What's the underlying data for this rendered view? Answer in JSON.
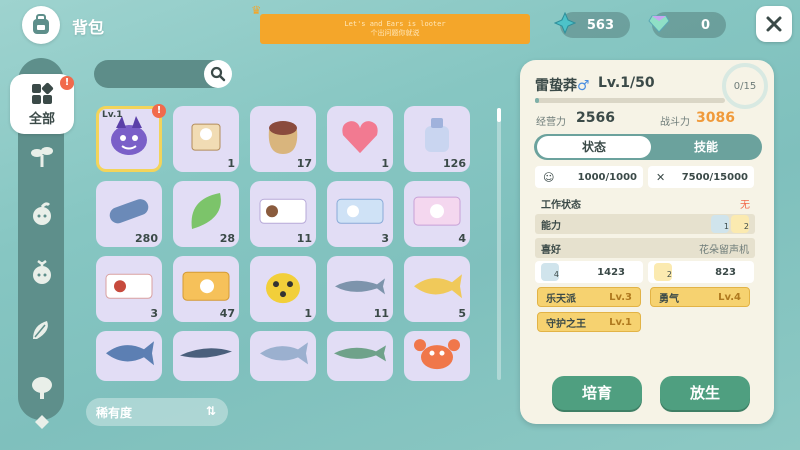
{
  "header": {
    "title": "背包",
    "notice_line1": "Let's and Ears is looter",
    "notice_line2": "个出问题你就说",
    "resources": [
      {
        "icon": "blue-crystal-icon",
        "value": "563"
      },
      {
        "icon": "rainbow-gem-icon",
        "value": "0"
      }
    ]
  },
  "sidebar": {
    "active_label": "全部",
    "active_badge": "!",
    "categories": [
      {
        "icon": "grid-icon",
        "label": "全部"
      },
      {
        "icon": "sprout-icon"
      },
      {
        "icon": "leaf-creature-icon"
      },
      {
        "icon": "sprout-creature-icon"
      },
      {
        "icon": "leaves-icon"
      },
      {
        "icon": "tree-icon"
      },
      {
        "icon": "diamond-icon"
      }
    ]
  },
  "search": {
    "placeholder": ""
  },
  "items": [
    {
      "name": "pet-purple-creature",
      "level": "Lv.1",
      "badge": "!",
      "count": ""
    },
    {
      "name": "cat-box",
      "count": "1"
    },
    {
      "name": "seed-sack",
      "count": "17"
    },
    {
      "name": "pink-heart",
      "count": "1"
    },
    {
      "name": "bottle",
      "count": "126"
    },
    {
      "name": "capsule",
      "count": "280"
    },
    {
      "name": "green-leaf",
      "count": "28"
    },
    {
      "name": "ticket",
      "count": "11"
    },
    {
      "name": "blue-ticket",
      "count": "3"
    },
    {
      "name": "pink-card",
      "count": "4"
    },
    {
      "name": "ticket-red",
      "count": "3"
    },
    {
      "name": "orange-ticket",
      "count": "47"
    },
    {
      "name": "ladybug",
      "count": "1"
    },
    {
      "name": "sturgeon",
      "count": "11"
    },
    {
      "name": "yellow-fish",
      "count": "5"
    },
    {
      "name": "blue-fish",
      "count": ""
    },
    {
      "name": "eel",
      "count": ""
    },
    {
      "name": "tuna",
      "count": ""
    },
    {
      "name": "green-fish",
      "count": ""
    },
    {
      "name": "crab",
      "count": ""
    }
  ],
  "rarity_label": "稀有度",
  "detail": {
    "name": "雷蛰莽",
    "gender_symbol": "♂",
    "level": "Lv.1/50",
    "counter": "0/15",
    "management_label": "经营力",
    "management_value": "2566",
    "combat_label": "战斗力",
    "combat_value": "3086",
    "tabs": [
      "状态",
      "技能"
    ],
    "hp": "1000/1000",
    "energy": "7500/15000",
    "work_status_label": "工作状态",
    "work_status_value": "无",
    "ability_label": "能力",
    "ability_badges": [
      "1",
      "2"
    ],
    "hobby_label": "喜好",
    "hobby_value": "花朵留声机",
    "stat_a": "1423",
    "stat_a_badge": "4",
    "stat_b": "823",
    "stat_b_badge": "2",
    "traits": [
      {
        "name": "乐天派",
        "level": "Lv.3"
      },
      {
        "name": "勇气",
        "level": "Lv.4"
      },
      {
        "name": "守护之王",
        "level": "Lv.1"
      }
    ],
    "buttons": {
      "nurture": "培育",
      "release": "放生"
    }
  },
  "colors": {
    "accent": "#4f9f80",
    "combat": "#f09a3a",
    "alert": "#f16a4c",
    "selected": "#f3d45a"
  }
}
